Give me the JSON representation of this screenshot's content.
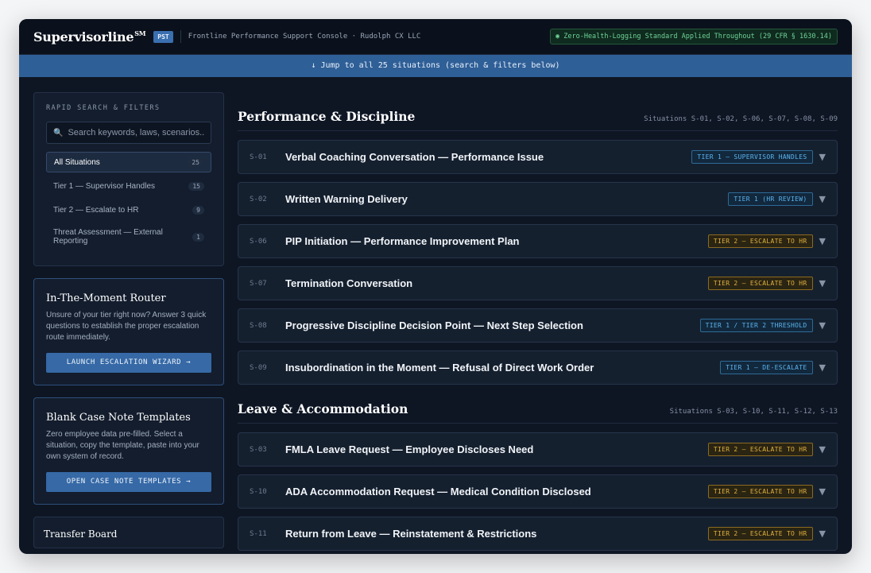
{
  "header": {
    "brand": "Supervisorline",
    "brand_mark": "SM",
    "pill": "PST",
    "subtitle": "Frontline Performance Support Console · Rudolph CX LLC",
    "compliance": "◉ Zero-Health-Logging Standard Applied Throughout (29 CFR § 1630.14)"
  },
  "jump_bar": "↓ Jump to all 25 situations (search & filters below)",
  "sidebar": {
    "search_label": "RAPID SEARCH & FILTERS",
    "search_placeholder": "Search keywords, laws, scenarios...",
    "search_icon": "🔍",
    "filters": [
      {
        "label": "All Situations",
        "count": "25"
      },
      {
        "label": "Tier 1 — Supervisor Handles",
        "count": "15"
      },
      {
        "label": "Tier 2 — Escalate to HR",
        "count": "9"
      },
      {
        "label": "Threat Assessment — External Reporting",
        "count": "1"
      }
    ],
    "router": {
      "title": "In-The-Moment Router",
      "text": "Unsure of your tier right now? Answer 3 quick questions to establish the proper escalation route immediately.",
      "button": "LAUNCH ESCALATION WIZARD →"
    },
    "templates": {
      "title": "Blank Case Note Templates",
      "text": "Zero employee data pre-filled. Select a situation, copy the template, paste into your own system of record.",
      "button": "OPEN CASE NOTE TEMPLATES →"
    },
    "transfer": {
      "title": "Transfer Board"
    }
  },
  "sections": [
    {
      "title": "Performance & Discipline",
      "ids": "Situations S-01, S-02, S-06, S-07, S-08, S-09",
      "rows": [
        {
          "id": "S-01",
          "title": "Verbal Coaching Conversation — Performance Issue",
          "tier": "TIER 1 — SUPERVISOR HANDLES",
          "kind": "t1"
        },
        {
          "id": "S-02",
          "title": "Written Warning Delivery",
          "tier": "TIER 1 (HR REVIEW)",
          "kind": "t1"
        },
        {
          "id": "S-06",
          "title": "PIP Initiation — Performance Improvement Plan",
          "tier": "TIER 2 — ESCALATE TO HR",
          "kind": "t2"
        },
        {
          "id": "S-07",
          "title": "Termination Conversation",
          "tier": "TIER 2 — ESCALATE TO HR",
          "kind": "t2"
        },
        {
          "id": "S-08",
          "title": "Progressive Discipline Decision Point — Next Step Selection",
          "tier": "TIER 1 / TIER 2 THRESHOLD",
          "kind": "t1"
        },
        {
          "id": "S-09",
          "title": "Insubordination in the Moment — Refusal of Direct Work Order",
          "tier": "TIER 1 — DE-ESCALATE",
          "kind": "t1"
        }
      ]
    },
    {
      "title": "Leave & Accommodation",
      "ids": "Situations S-03, S-10, S-11, S-12, S-13",
      "rows": [
        {
          "id": "S-03",
          "title": "FMLA Leave Request — Employee Discloses Need",
          "tier": "TIER 2 — ESCALATE TO HR",
          "kind": "t2"
        },
        {
          "id": "S-10",
          "title": "ADA Accommodation Request — Medical Condition Disclosed",
          "tier": "TIER 2 — ESCALATE TO HR",
          "kind": "t2"
        },
        {
          "id": "S-11",
          "title": "Return from Leave — Reinstatement & Restrictions",
          "tier": "TIER 2 — ESCALATE TO HR",
          "kind": "t2"
        }
      ]
    }
  ],
  "chevron": "▼"
}
